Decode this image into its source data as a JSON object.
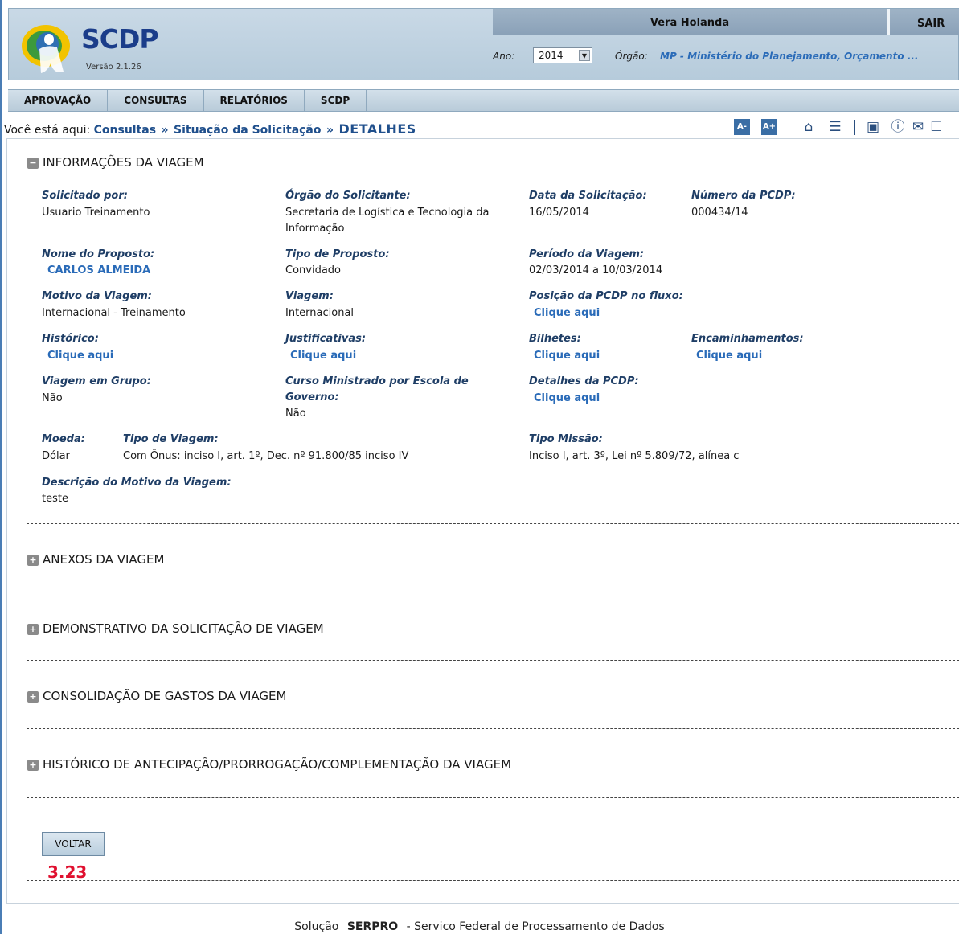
{
  "app": {
    "logo_title": "SCDP",
    "version": "Versão 2.1.26"
  },
  "userbar": {
    "user_name": "Vera Holanda",
    "logout_label": "SAIR"
  },
  "filters": {
    "ano_label": "Ano:",
    "ano_value": "2014",
    "orgao_label": "Órgão:",
    "orgao_value": "MP - Ministério do Planejamento, Orçamento ..."
  },
  "menu": [
    {
      "label": "APROVAÇÃO"
    },
    {
      "label": "CONSULTAS"
    },
    {
      "label": "RELATÓRIOS"
    },
    {
      "label": "SCDP"
    }
  ],
  "breadcrumb": {
    "prefix": "Você está aqui:",
    "items": [
      "Consultas",
      "Situação da Solicitação"
    ],
    "current": "DETALHES"
  },
  "toolbar": {
    "font_decrease": "A-",
    "font_increase": "A+",
    "icons": [
      "home-icon",
      "comment-icon",
      "video-icon",
      "help-icon",
      "mail-icon",
      "chat-icon"
    ]
  },
  "sections": {
    "info_title": "INFORMAÇÕES DA VIAGEM",
    "anexos_title": "ANEXOS DA VIAGEM",
    "demonstrativo_title": "DEMONSTRATIVO DA SOLICITAÇÃO DE VIAGEM",
    "consolidacao_title": "CONSOLIDAÇÃO DE GASTOS DA VIAGEM",
    "historico_title": "HISTÓRICO DE ANTECIPAÇÃO/PRORROGAÇÃO/COMPLEMENTAÇÃO DA VIAGEM"
  },
  "fields": {
    "solicitado_por_label": "Solicitado por:",
    "solicitado_por_value": "Usuario Treinamento",
    "orgao_solicitante_label": "Órgão do Solicitante:",
    "orgao_solicitante_value": "Secretaria de Logística e Tecnologia da",
    "orgao_solicitante_value2": "Informação",
    "data_solicitacao_label": "Data da Solicitação:",
    "data_solicitacao_value": "16/05/2014",
    "numero_pcdp_label": "Número da PCDP:",
    "numero_pcdp_value": "000434/14",
    "nome_proposto_label": "Nome do Proposto:",
    "nome_proposto_value": "CARLOS ALMEIDA",
    "tipo_proposto_label": "Tipo de Proposto:",
    "tipo_proposto_value": "Convidado",
    "periodo_label": "Período da Viagem:",
    "periodo_value": "02/03/2014 a 10/03/2014",
    "motivo_label": "Motivo da Viagem:",
    "motivo_value": "Internacional - Treinamento",
    "viagem_label": "Viagem:",
    "viagem_value": "Internacional",
    "posicao_label": "Posição da PCDP no fluxo:",
    "posicao_link": "Clique aqui",
    "historico_label": "Histórico:",
    "historico_link": "Clique aqui",
    "justificativas_label": "Justificativas:",
    "justificativas_link": "Clique aqui",
    "bilhetes_label": "Bilhetes:",
    "bilhetes_link": "Clique aqui",
    "encaminhamentos_label": "Encaminhamentos:",
    "encaminhamentos_link": "Clique aqui",
    "grupo_label": "Viagem em Grupo:",
    "grupo_value": "Não",
    "curso_label": "Curso Ministrado por Escola de",
    "curso_label2": "Governo:",
    "curso_value": "Não",
    "detalhes_label": "Detalhes da PCDP:",
    "detalhes_link": "Clique aqui",
    "moeda_label": "Moeda:",
    "moeda_value": "Dólar",
    "tipo_viagem_label": "Tipo de Viagem:",
    "tipo_viagem_value": "Com Ônus: inciso I, art. 1º, Dec. nº 91.800/85 inciso IV",
    "tipo_missao_label": "Tipo Missão:",
    "tipo_missao_value": "Inciso I, art. 3º, Lei nº 5.809/72, alínea c",
    "descricao_label": "Descrição do Motivo da Viagem:",
    "descricao_value": "teste"
  },
  "actions": {
    "voltar_label": "VOLTAR"
  },
  "version_stamp": "3.23",
  "footer": {
    "prefix": "Solução",
    "brand": "SERPRO",
    "suffix": "- Servico Federal de Processamento de Dados"
  }
}
